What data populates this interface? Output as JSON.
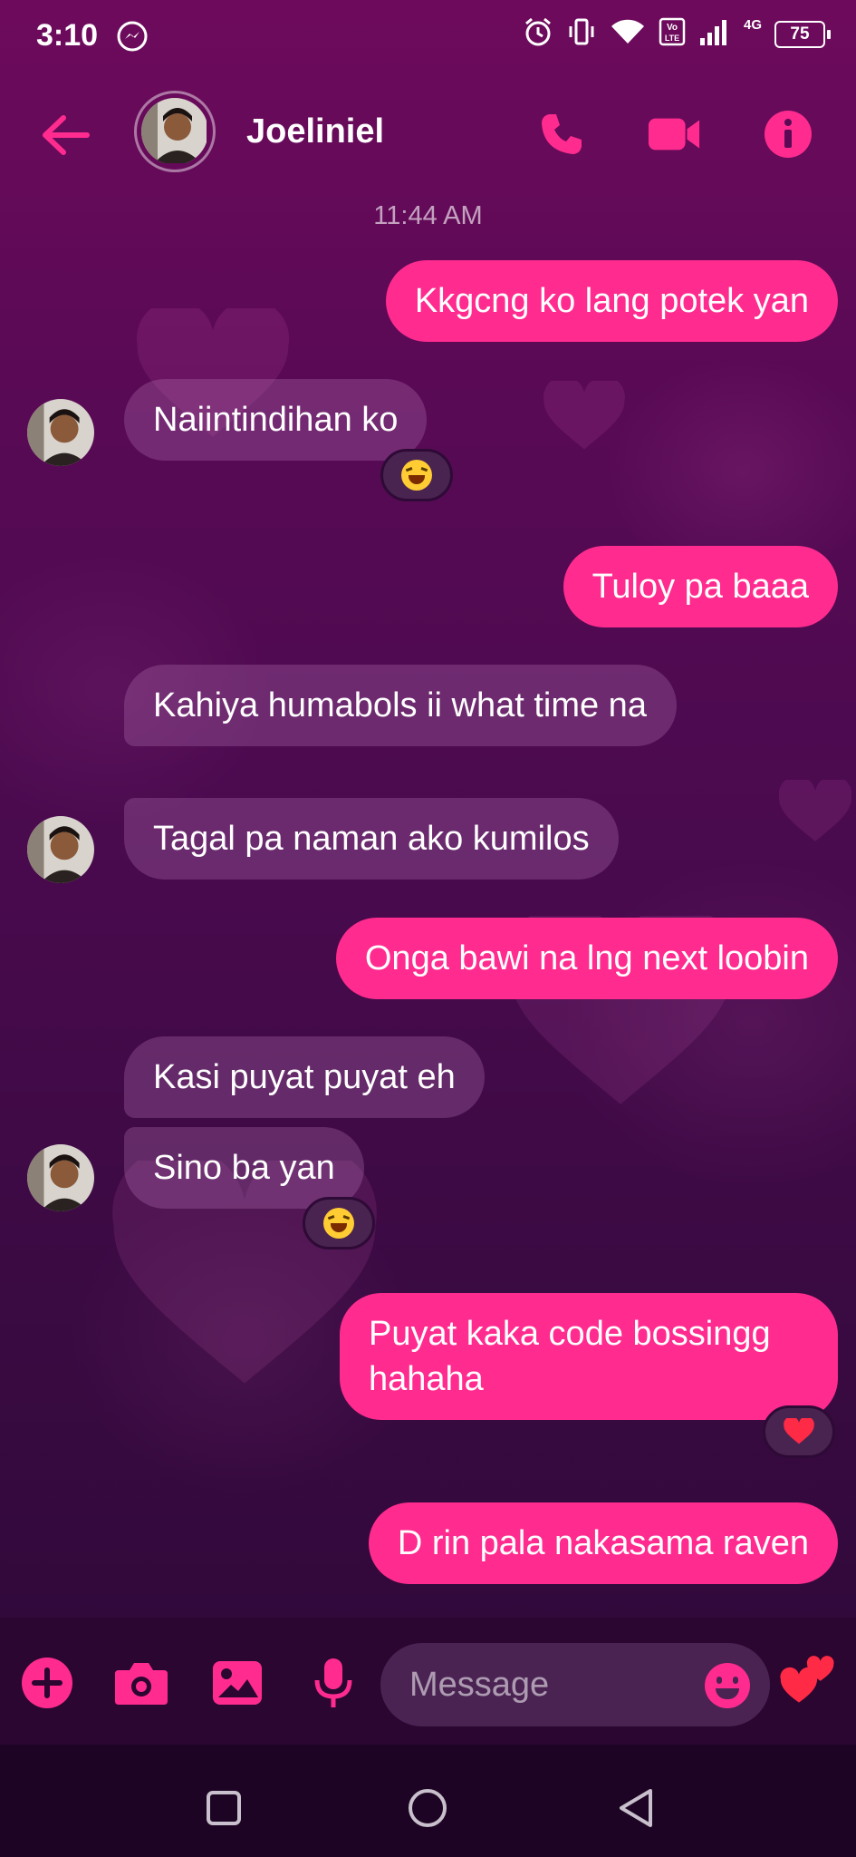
{
  "status_bar": {
    "time": "3:10",
    "network_label": "4G",
    "battery": "75"
  },
  "header": {
    "contact_name": "Joeliniel"
  },
  "chat": {
    "timestamp": "11:44 AM",
    "messages": [
      {
        "side": "out",
        "text": "Kkgcng ko lang potek yan"
      },
      {
        "side": "in",
        "text": "Naiintindihan ko",
        "reaction": "grinning-squinting-face"
      },
      {
        "side": "out",
        "text": "Tuloy pa baaa"
      },
      {
        "side": "in",
        "text": "Kahiya humabols ii what time na"
      },
      {
        "side": "in",
        "text": "Tagal pa naman ako kumilos"
      },
      {
        "side": "out",
        "text": "Onga bawi na lng next loobin"
      },
      {
        "side": "in",
        "text": "Kasi puyat puyat eh"
      },
      {
        "side": "in",
        "text": "Sino ba yan",
        "reaction": "grinning-squinting-face"
      },
      {
        "side": "out",
        "text": "Puyat kaka code bossingg hahaha",
        "reaction": "red-heart"
      },
      {
        "side": "out",
        "text": "D rin pala nakasama raven"
      }
    ]
  },
  "composer": {
    "placeholder": "Message",
    "icons": [
      "plus-icon",
      "camera-icon",
      "gallery-icon",
      "microphone-icon",
      "emoji-icon",
      "hearts-quick-reaction-icon"
    ]
  },
  "colors": {
    "accent": "#ff2b8f",
    "incoming_bubble": "#6b3470",
    "background_top": "#6e0a5c",
    "background_bottom": "#2c0836"
  }
}
